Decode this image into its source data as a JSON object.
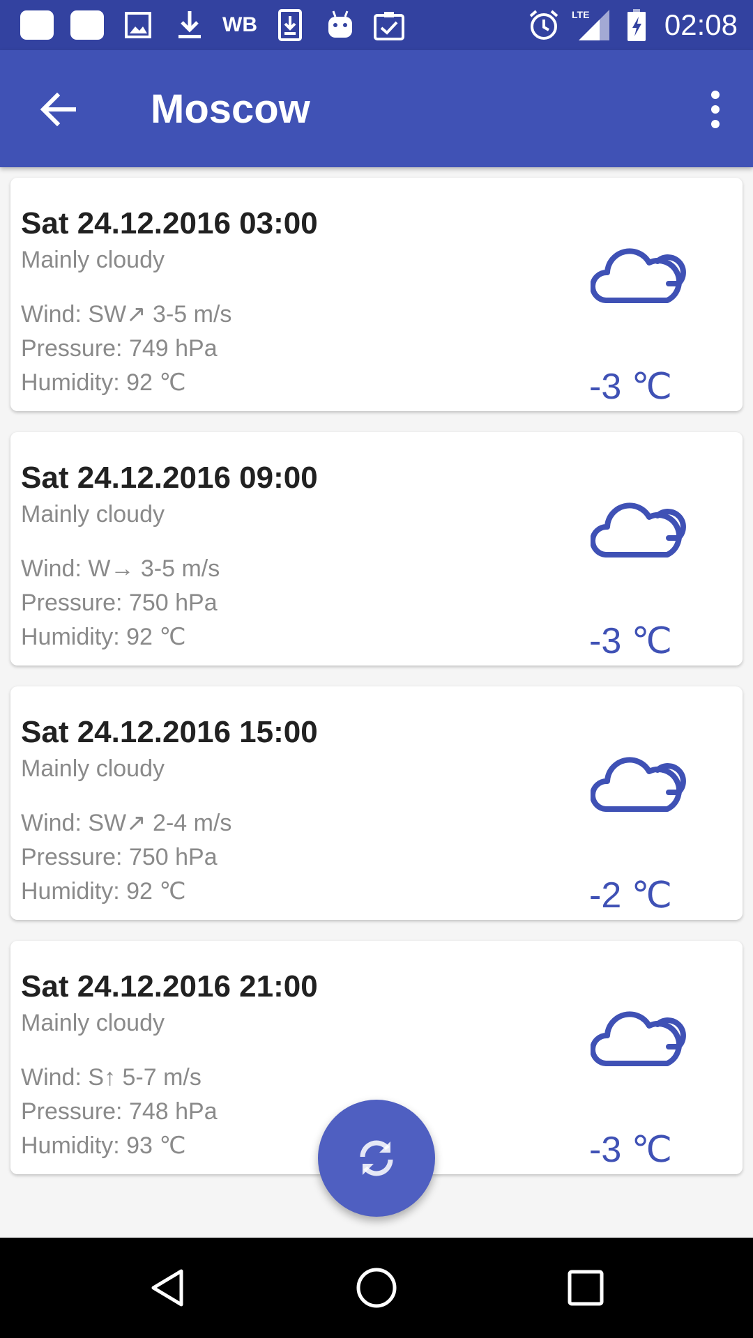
{
  "status_bar": {
    "wb_label": "WB",
    "lte_label": "LTE",
    "time": "02:08"
  },
  "app_bar": {
    "title": "Moscow"
  },
  "forecasts": [
    {
      "datetime": "Sat 24.12.2016 03:00",
      "condition": "Mainly cloudy",
      "wind": "Wind: SW↗ 3-5 m/s",
      "pressure": "Pressure: 749 hPa",
      "humidity": "Humidity: 92 ℃",
      "temperature": "-3 ℃",
      "icon": "cloudy-icon"
    },
    {
      "datetime": "Sat 24.12.2016 09:00",
      "condition": "Mainly cloudy",
      "wind": "Wind: W→ 3-5 m/s",
      "pressure": "Pressure: 750 hPa",
      "humidity": "Humidity: 92 ℃",
      "temperature": "-3 ℃",
      "icon": "cloudy-icon"
    },
    {
      "datetime": "Sat 24.12.2016 15:00",
      "condition": "Mainly cloudy",
      "wind": "Wind: SW↗ 2-4 m/s",
      "pressure": "Pressure: 750 hPa",
      "humidity": "Humidity: 92 ℃",
      "temperature": "-2 ℃",
      "icon": "cloudy-icon"
    },
    {
      "datetime": "Sat 24.12.2016 21:00",
      "condition": "Mainly cloudy",
      "wind": "Wind: S↑ 5-7 m/s",
      "pressure": "Pressure: 748 hPa",
      "humidity": "Humidity: 93 ℃",
      "temperature": "-3 ℃",
      "icon": "cloudy-icon"
    }
  ],
  "fab": {
    "icon": "refresh-icon"
  },
  "nav_bar": {
    "icons": [
      "back-triangle-icon",
      "home-circle-icon",
      "recents-square-icon"
    ]
  },
  "colors": {
    "status_bar": "#3342a0",
    "app_bar": "#4052b5",
    "accent": "#3f51b5",
    "fab": "#4f5fc1",
    "background": "#f5f5f5"
  }
}
